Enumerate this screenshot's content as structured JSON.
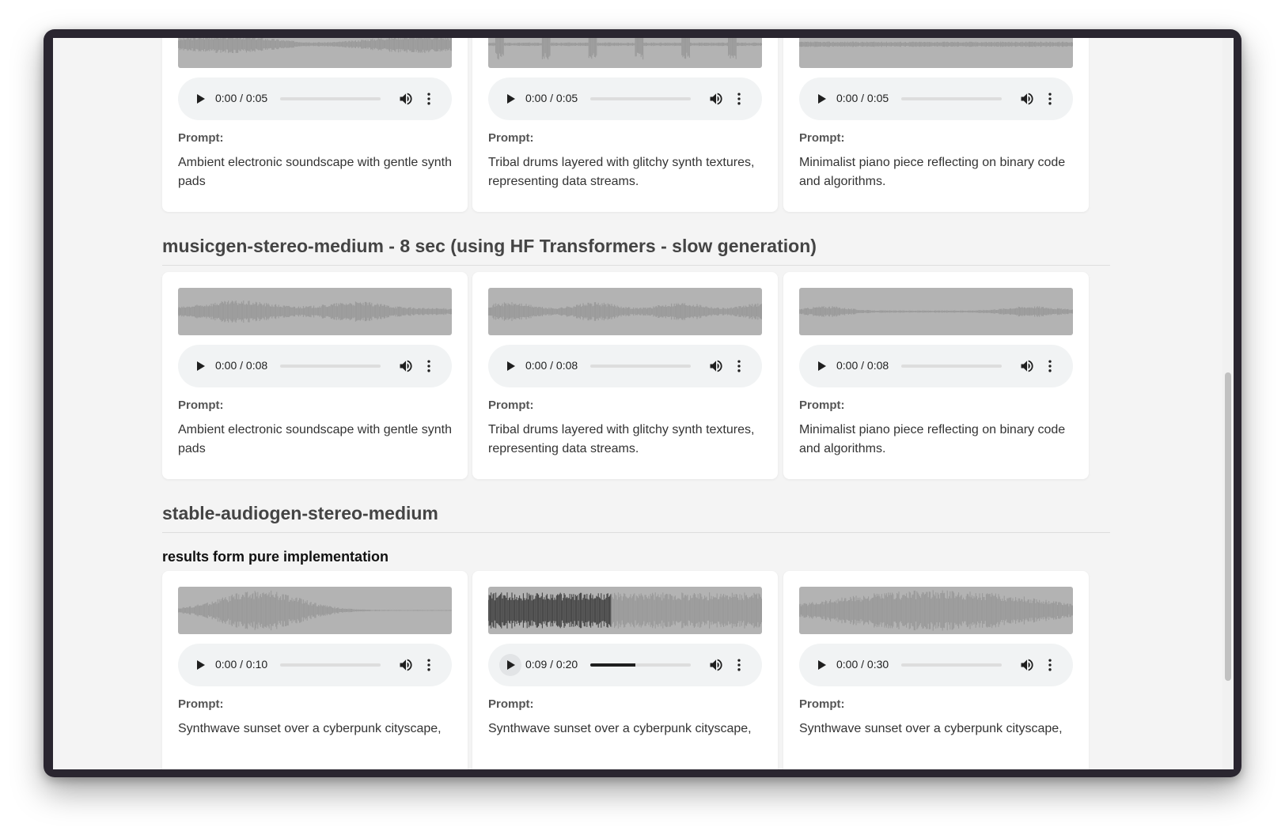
{
  "sections": [
    {
      "title": "",
      "cards": [
        {
          "time": "0:00 / 0:05",
          "progress": 0.0,
          "prompt_label": "Prompt:",
          "prompt": "Ambient electronic soundscape with gentle synth pads"
        },
        {
          "time": "0:00 / 0:05",
          "progress": 0.0,
          "prompt_label": "Prompt:",
          "prompt": "Tribal drums layered with glitchy synth textures, representing data streams."
        },
        {
          "time": "0:00 / 0:05",
          "progress": 0.0,
          "prompt_label": "Prompt:",
          "prompt": "Minimalist piano piece reflecting on binary code and algorithms."
        }
      ]
    },
    {
      "title": "musicgen-stereo-medium - 8 sec (using HF Transformers - slow generation)",
      "cards": [
        {
          "time": "0:00 / 0:08",
          "progress": 0.0,
          "prompt_label": "Prompt:",
          "prompt": "Ambient electronic soundscape with gentle synth pads"
        },
        {
          "time": "0:00 / 0:08",
          "progress": 0.0,
          "prompt_label": "Prompt:",
          "prompt": "Tribal drums layered with glitchy synth textures, representing data streams."
        },
        {
          "time": "0:00 / 0:08",
          "progress": 0.0,
          "prompt_label": "Prompt:",
          "prompt": "Minimalist piano piece reflecting on binary code and algorithms."
        }
      ]
    },
    {
      "title": "stable-audiogen-stereo-medium",
      "subtitle": "results form pure implementation",
      "cards": [
        {
          "time": "0:00 / 0:10",
          "progress": 0.0,
          "prompt_label": "Prompt:",
          "prompt": "Synthwave sunset over a cyberpunk cityscape,"
        },
        {
          "time": "0:09 / 0:20",
          "progress": 0.45,
          "prompt_label": "Prompt:",
          "prompt": "Synthwave sunset over a cyberpunk cityscape,"
        },
        {
          "time": "0:00 / 0:30",
          "progress": 0.0,
          "prompt_label": "Prompt:",
          "prompt": "Synthwave sunset over a cyberpunk cityscape,"
        }
      ]
    }
  ],
  "icons": {
    "play": "play-icon",
    "volume": "volume-icon",
    "more": "more-vert-icon"
  },
  "colors": {
    "page_bg": "#f4f4f4",
    "card_bg": "#ffffff",
    "waveform_bg": "#b3b3b3",
    "waveform": "#9a9a9a",
    "waveform_played": "#444444"
  }
}
